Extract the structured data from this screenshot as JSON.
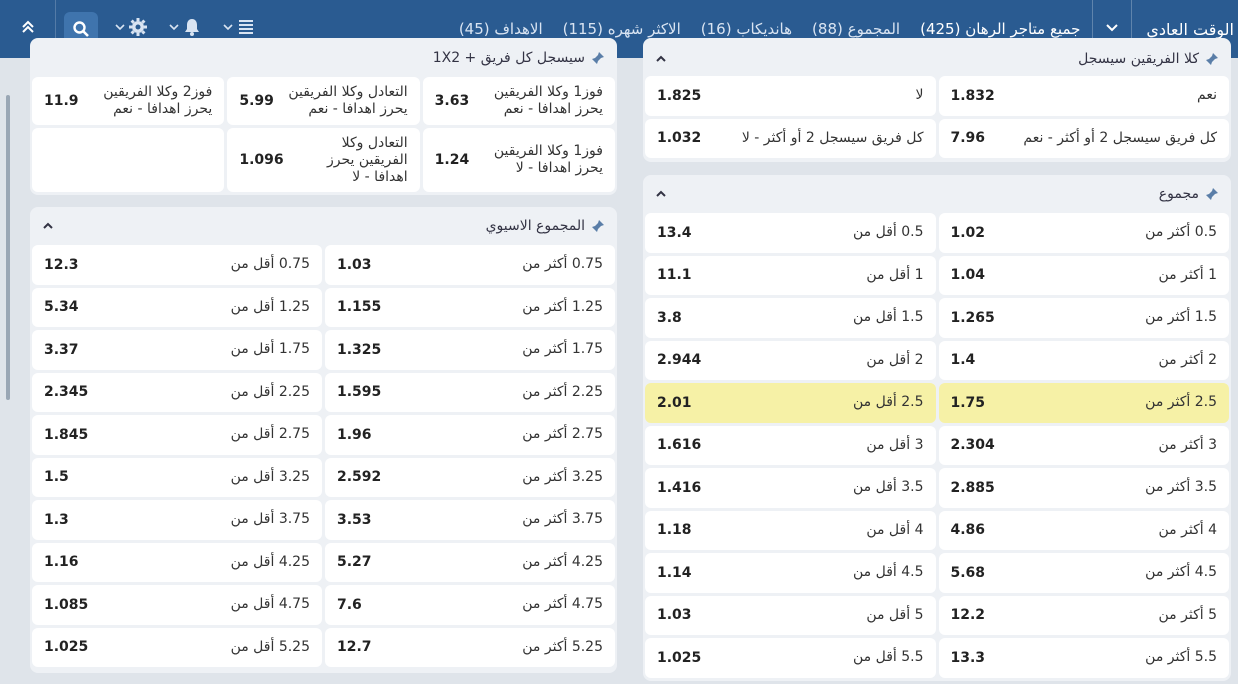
{
  "header": {
    "title": "الوقت العادي",
    "tabs": [
      {
        "label": "جميع متاجر الرهان (425)",
        "active": true
      },
      {
        "label": "المجموع (88)"
      },
      {
        "label": "هانديكاب (16)"
      },
      {
        "label": "الاكثر شهره (115)"
      },
      {
        "label": "الاهداف (45)"
      }
    ]
  },
  "colors": {
    "topbar": "#2a5b91",
    "active_tab_underline": "#9ccb3c",
    "highlight": "#f6f1a6"
  },
  "icons": [
    "chevron-down-icon",
    "list-icon",
    "bell-icon",
    "gear-icon",
    "search-icon",
    "double-chevron-up-icon",
    "pin-icon",
    "chevron-up-icon"
  ],
  "btts_panel": {
    "title": "كلا الفريقين سيسجل",
    "rows": [
      [
        {
          "label": "نعم",
          "odd": "1.832"
        },
        {
          "label": "لا",
          "odd": "1.825"
        }
      ],
      [
        {
          "label": "كل فريق سيسجل 2 أو أكثر - نعم",
          "odd": "7.96"
        },
        {
          "label": "كل فريق سيسجل 2 أو أكثر - لا",
          "odd": "1.032"
        }
      ]
    ]
  },
  "combo_panel": {
    "title": "1X2 + سيسجل كل فريق",
    "rows": [
      [
        {
          "label": "فوز1 وكلا الفريقين يحرز اهدافا - نعم",
          "odd": "3.63"
        },
        {
          "label": "التعادل وكلا الفريقين يحرز اهدافا - نعم",
          "odd": "5.99"
        },
        {
          "label": "فوز2 وكلا الفريقين يحرز اهدافا - نعم",
          "odd": "11.9"
        }
      ],
      [
        {
          "label": "فوز1 وكلا الفريقين يحرز اهدافا - لا",
          "odd": "1.24"
        },
        {
          "label": "التعادل وكلا الفريقين يحرز اهدافا - لا",
          "odd": "1.096"
        },
        {
          "label": "",
          "odd": ""
        }
      ]
    ]
  },
  "total_panel": {
    "title": "مجموع",
    "rows": [
      [
        {
          "label": "0.5 أكثر من",
          "odd": "1.02"
        },
        {
          "label": "0.5 أقل من",
          "odd": "13.4"
        }
      ],
      [
        {
          "label": "1 أكثر من",
          "odd": "1.04"
        },
        {
          "label": "1 أقل من",
          "odd": "11.1"
        }
      ],
      [
        {
          "label": "1.5 أكثر من",
          "odd": "1.265"
        },
        {
          "label": "1.5 أقل من",
          "odd": "3.8"
        }
      ],
      [
        {
          "label": "2 أكثر من",
          "odd": "1.4"
        },
        {
          "label": "2 أقل من",
          "odd": "2.944"
        }
      ],
      [
        {
          "label": "2.5 أكثر من",
          "odd": "1.75"
        },
        {
          "label": "2.5 أقل من",
          "odd": "2.01"
        }
      ],
      [
        {
          "label": "3 أكثر من",
          "odd": "2.304"
        },
        {
          "label": "3 أقل من",
          "odd": "1.616"
        }
      ],
      [
        {
          "label": "3.5 أكثر من",
          "odd": "2.885"
        },
        {
          "label": "3.5 أقل من",
          "odd": "1.416"
        }
      ],
      [
        {
          "label": "4 أكثر من",
          "odd": "4.86"
        },
        {
          "label": "4 أقل من",
          "odd": "1.18"
        }
      ],
      [
        {
          "label": "4.5 أكثر من",
          "odd": "5.68"
        },
        {
          "label": "4.5 أقل من",
          "odd": "1.14"
        }
      ],
      [
        {
          "label": "5 أكثر من",
          "odd": "12.2"
        },
        {
          "label": "5 أقل من",
          "odd": "1.03"
        }
      ],
      [
        {
          "label": "5.5 أكثر من",
          "odd": "13.3"
        },
        {
          "label": "5.5 أقل من",
          "odd": "1.025"
        }
      ]
    ],
    "highlighted_row": 4
  },
  "asian_panel": {
    "title": "المجموع الاسيوي",
    "rows": [
      [
        {
          "label": "0.75 أكثر من",
          "odd": "1.03"
        },
        {
          "label": "0.75 أقل من",
          "odd": "12.3"
        }
      ],
      [
        {
          "label": "1.25 أكثر من",
          "odd": "1.155"
        },
        {
          "label": "1.25 أقل من",
          "odd": "5.34"
        }
      ],
      [
        {
          "label": "1.75 أكثر من",
          "odd": "1.325"
        },
        {
          "label": "1.75 أقل من",
          "odd": "3.37"
        }
      ],
      [
        {
          "label": "2.25 أكثر من",
          "odd": "1.595"
        },
        {
          "label": "2.25 أقل من",
          "odd": "2.345"
        }
      ],
      [
        {
          "label": "2.75 أكثر من",
          "odd": "1.96"
        },
        {
          "label": "2.75 أقل من",
          "odd": "1.845"
        }
      ],
      [
        {
          "label": "3.25 أكثر من",
          "odd": "2.592"
        },
        {
          "label": "3.25 أقل من",
          "odd": "1.5"
        }
      ],
      [
        {
          "label": "3.75 أكثر من",
          "odd": "3.53"
        },
        {
          "label": "3.75 أقل من",
          "odd": "1.3"
        }
      ],
      [
        {
          "label": "4.25 أكثر من",
          "odd": "5.27"
        },
        {
          "label": "4.25 أقل من",
          "odd": "1.16"
        }
      ],
      [
        {
          "label": "4.75 أكثر من",
          "odd": "7.6"
        },
        {
          "label": "4.75 أقل من",
          "odd": "1.085"
        }
      ],
      [
        {
          "label": "5.25 أكثر من",
          "odd": "12.7"
        },
        {
          "label": "5.25 أقل من",
          "odd": "1.025"
        }
      ]
    ]
  }
}
